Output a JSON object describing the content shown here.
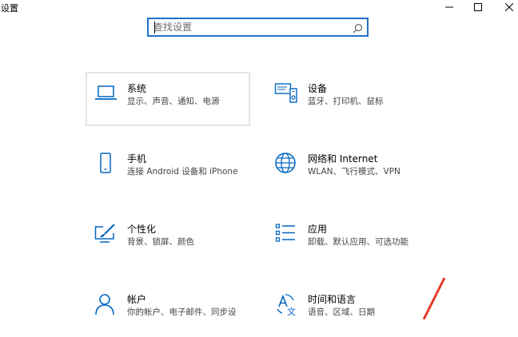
{
  "window": {
    "title": "设置",
    "minimize_icon": "minimize-icon",
    "maximize_icon": "maximize-icon",
    "close_icon": "close-icon"
  },
  "search": {
    "placeholder": "查找设置",
    "icon": "search-icon"
  },
  "tiles": [
    {
      "title": "系统",
      "desc": "显示、声音、通知、电源",
      "icon": "laptop-icon"
    },
    {
      "title": "设备",
      "desc": "蓝牙、打印机、鼠标",
      "icon": "devices-icon"
    },
    {
      "title": "手机",
      "desc": "连接 Android 设备和 iPhone",
      "icon": "phone-icon"
    },
    {
      "title": "网络和 Internet",
      "desc": "WLAN、飞行模式、VPN",
      "icon": "globe-icon"
    },
    {
      "title": "个性化",
      "desc": "背景、锁屏、颜色",
      "icon": "personalization-icon"
    },
    {
      "title": "应用",
      "desc": "卸载、默认应用、可选功能",
      "icon": "apps-list-icon"
    },
    {
      "title": "帐户",
      "desc": "你的帐户、电子邮件、同步设",
      "icon": "person-icon"
    },
    {
      "title": "时间和语言",
      "desc": "语音、区域、日期",
      "icon": "time-language-icon"
    }
  ],
  "colors": {
    "accent": "#0067c0",
    "search_border": "#1f70c8",
    "annotation": "#e53b2c"
  }
}
